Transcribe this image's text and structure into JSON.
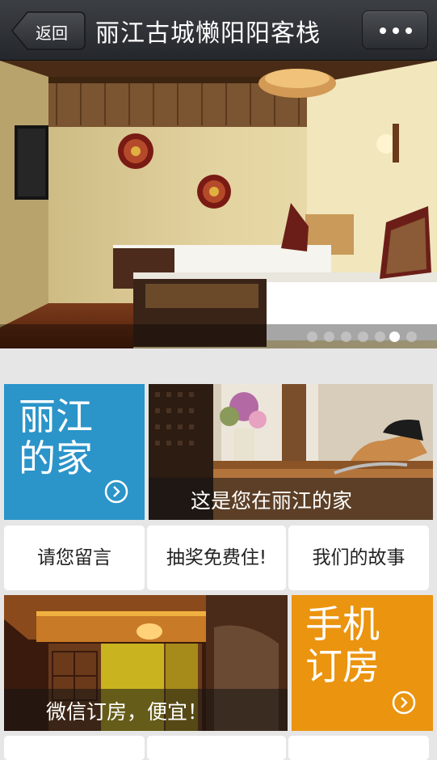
{
  "navbar": {
    "back_label": "返回",
    "title": "丽江古城懒阳阳客栈",
    "more_icon": "ellipsis-icon"
  },
  "banner": {
    "slide_count": 7,
    "active_slide": 6
  },
  "tiles": {
    "home_title_line1": "丽江",
    "home_title_line2": "的家",
    "home_caption": "这是您在丽江的家",
    "booking_title_line1": "手机",
    "booking_title_line2": "订房",
    "booking_caption": "微信订房，便宜！"
  },
  "buttons": {
    "message": "请您留言",
    "lottery": "抽奖免费住!",
    "story": "我们的故事"
  },
  "colors": {
    "blue_tile": "#2b94c9",
    "orange_tile": "#eb940f",
    "navbar": "#2f3236"
  }
}
